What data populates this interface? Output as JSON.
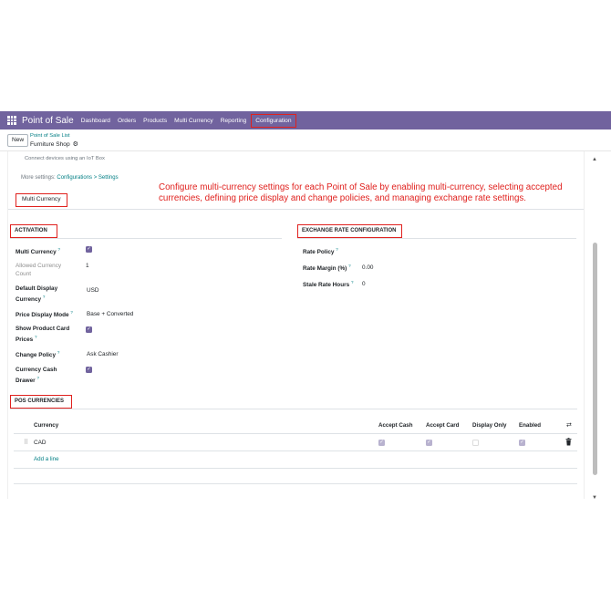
{
  "navbar": {
    "brand": "Point of Sale",
    "items": [
      "Dashboard",
      "Orders",
      "Products",
      "Multi Currency",
      "Reporting",
      "Configuration"
    ],
    "active": "Configuration",
    "bg_color": "#71639e"
  },
  "control_bar": {
    "new_label": "New",
    "breadcrumb": "Point of Sale List",
    "record_title": "Furniture Shop"
  },
  "settings": {
    "iot_text": "Connect devices using an IoT Box",
    "more_settings_prefix": "More settings: ",
    "more_settings_link": "Configurations > Settings",
    "tab_label": "Multi Currency"
  },
  "instruction": "Configure multi-currency settings for each Point of Sale by enabling multi-currency, selecting accepted currencies, defining price display and change policies, and managing exchange rate settings.",
  "activation": {
    "title": "ACTIVATION",
    "multi_currency_label": "Multi Currency",
    "multi_currency_checked": true,
    "allowed_count_label_1": "Allowed Currency",
    "allowed_count_label_2": "Count",
    "allowed_count_value": "1",
    "default_display_label_1": "Default Display",
    "default_display_label_2": "Currency",
    "default_display_value": "USD",
    "price_display_label": "Price Display Mode",
    "price_display_value": "Base + Converted",
    "show_prices_label_1": "Show Product Card",
    "show_prices_label_2": "Prices",
    "show_prices_checked": true,
    "change_policy_label": "Change Policy",
    "change_policy_value": "Ask Cashier",
    "cash_drawer_label_1": "Currency Cash",
    "cash_drawer_label_2": "Drawer",
    "cash_drawer_checked": true
  },
  "exchange": {
    "title": "EXCHANGE RATE CONFIGURATION",
    "rate_policy_label": "Rate Policy",
    "rate_policy_value": "",
    "rate_margin_label": "Rate Margin (%)",
    "rate_margin_value": "0.00",
    "stale_hours_label": "Stale Rate Hours",
    "stale_hours_value": "0"
  },
  "pos_currencies": {
    "title": "POS CURRENCIES",
    "columns": [
      "Currency",
      "Accept Cash",
      "Accept Card",
      "Display Only",
      "Enabled"
    ],
    "rows": [
      {
        "currency": "CAD",
        "accept_cash": true,
        "accept_card": true,
        "display_only": false,
        "enabled": true
      }
    ],
    "add_line": "Add a line"
  },
  "help_mark": "?",
  "colors": {
    "accent": "#71639e",
    "highlight": "#e0211e",
    "link": "#017e84"
  }
}
